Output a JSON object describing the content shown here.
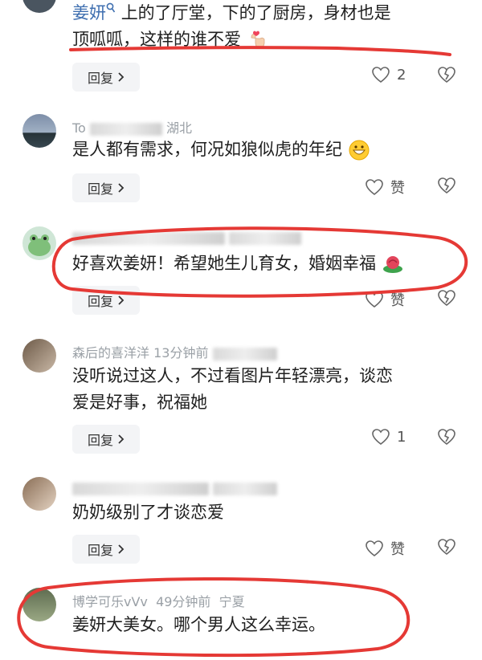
{
  "comments": [
    {
      "author": "姜妍",
      "text_line1": "上的了厅堂，下的了厨房，身材也是",
      "text_line2": "顶呱呱，这样的谁不爱",
      "reply_label": "回复",
      "like_count": "2"
    },
    {
      "author": "To",
      "location": "湖北",
      "text": "是人都有需求，何况如狼似虎的年纪",
      "reply_label": "回复",
      "like_label": "赞"
    },
    {
      "text": "好喜欢姜妍！希望她生儿育女，婚姻幸福",
      "reply_label": "回复",
      "like_label": "赞"
    },
    {
      "author": "森后的喜洋洋",
      "time": "13分钟前",
      "text_line1": "没听说过这人，不过看图片年轻漂亮，谈恋",
      "text_line2": "爱是好事，祝福她",
      "reply_label": "回复",
      "like_count": "1"
    },
    {
      "text": "奶奶级别了才谈恋爱",
      "reply_label": "回复",
      "like_label": "赞"
    },
    {
      "author": "博学可乐vVv",
      "time": "49分钟前",
      "location": "宁夏",
      "text": "姜妍大美女。哪个男人这么幸运。"
    }
  ],
  "icons": {
    "heart": "heart-icon",
    "broken_heart": "broken-heart-icon",
    "chevron": "chevron-right-icon",
    "search": "search-icon"
  },
  "colors": {
    "annotation_red": "#e53935",
    "author_blue": "#3f6fb0",
    "meta_gray": "#9aa0a6"
  }
}
